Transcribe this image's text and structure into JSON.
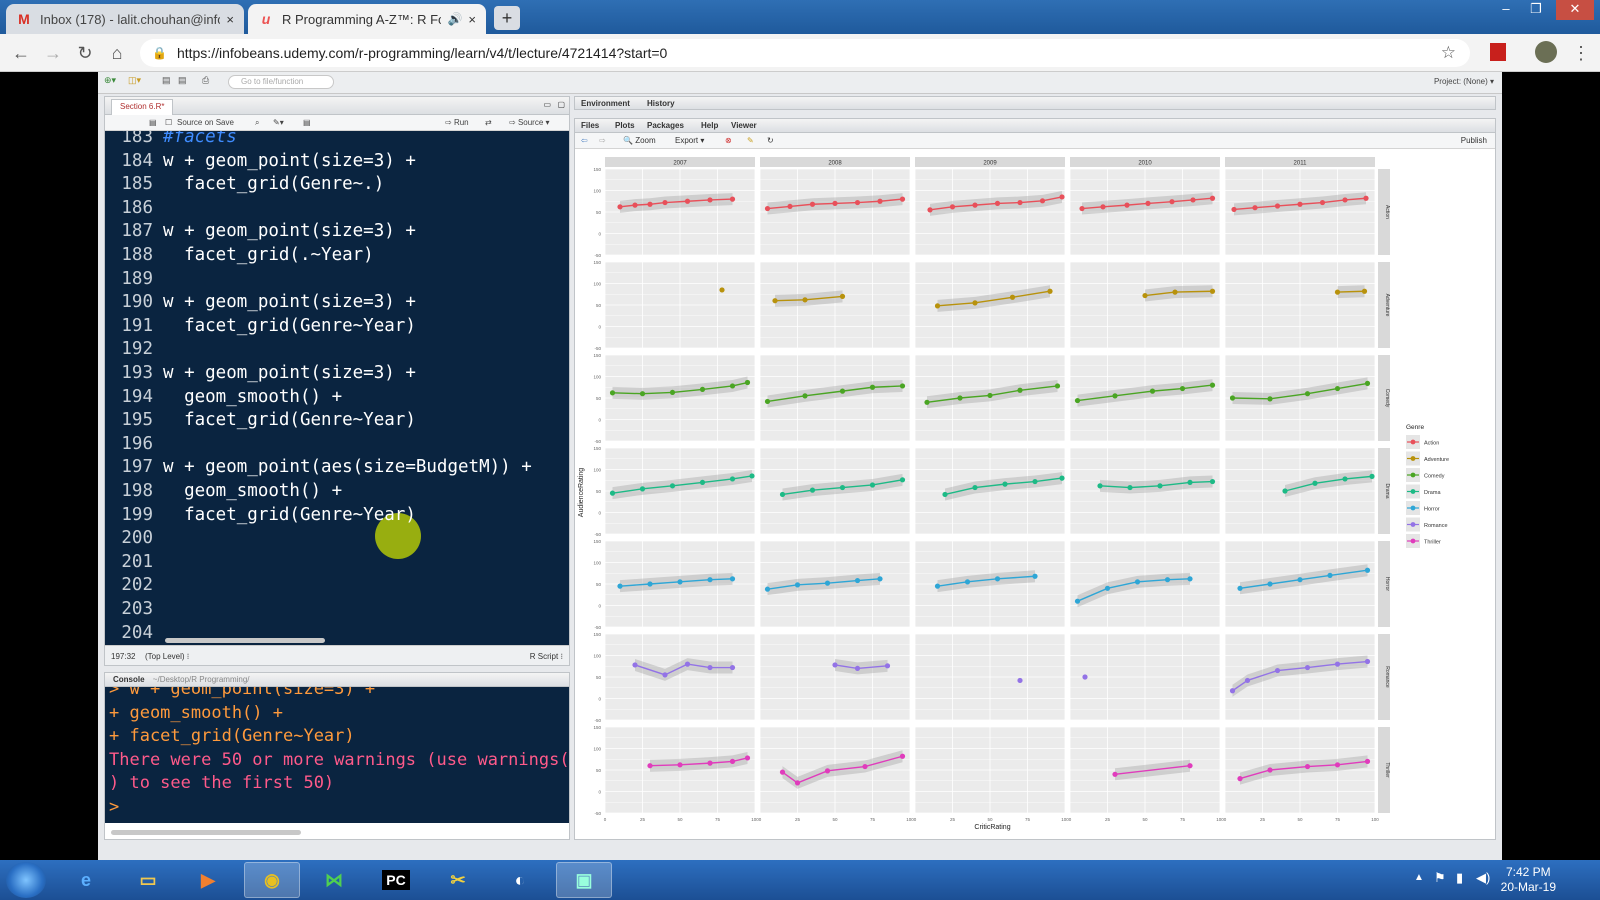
{
  "browser": {
    "tabs": [
      {
        "icon": "M",
        "title": "Inbox (178) - lalit.chouhan@infob",
        "close": "×"
      },
      {
        "icon": "u",
        "title": "R Programming A-Z™: R For",
        "close": "×"
      }
    ],
    "new_tab": "+",
    "url": "https://infobeans.udemy.com/r-programming/learn/v4/t/lecture/4721414?start=0"
  },
  "rstudio": {
    "toolbar": {
      "goto_placeholder": "Go to file/function",
      "project": "Project: (None) ▾"
    },
    "source": {
      "tab": "Section 6.R*",
      "tools": {
        "source_on_save": "Source on Save",
        "run": "Run",
        "source": "Source"
      },
      "lines": [
        {
          "n": "183",
          "code": "#facets",
          "kind": "comment"
        },
        {
          "n": "184",
          "code": "w + geom_point(size=3) +"
        },
        {
          "n": "185",
          "code": "  facet_grid(Genre~.)"
        },
        {
          "n": "186",
          "code": ""
        },
        {
          "n": "187",
          "code": "w + geom_point(size=3) +"
        },
        {
          "n": "188",
          "code": "  facet_grid(.~Year)"
        },
        {
          "n": "189",
          "code": ""
        },
        {
          "n": "190",
          "code": "w + geom_point(size=3) +"
        },
        {
          "n": "191",
          "code": "  facet_grid(Genre~Year)"
        },
        {
          "n": "192",
          "code": ""
        },
        {
          "n": "193",
          "code": "w + geom_point(size=3) +"
        },
        {
          "n": "194",
          "code": "  geom_smooth() +"
        },
        {
          "n": "195",
          "code": "  facet_grid(Genre~Year)"
        },
        {
          "n": "196",
          "code": ""
        },
        {
          "n": "197",
          "code": "w + geom_point(aes(size=BudgetM)) +"
        },
        {
          "n": "198",
          "code": "  geom_smooth() +"
        },
        {
          "n": "199",
          "code": "  facet_grid(Genre~Year)"
        },
        {
          "n": "200",
          "code": ""
        },
        {
          "n": "201",
          "code": ""
        },
        {
          "n": "202",
          "code": ""
        },
        {
          "n": "203",
          "code": ""
        },
        {
          "n": "204",
          "code": ""
        }
      ],
      "status": {
        "position": "197:32",
        "scope": "(Top Level) ⁝",
        "type": "R Script ⁝"
      }
    },
    "console": {
      "title": "Console",
      "path": "~/Desktop/R Programming/",
      "lines": [
        {
          "text": "> w + geom_point(size=3) +",
          "color": "orange"
        },
        {
          "text": "+ geom_smooth() +",
          "color": "orange"
        },
        {
          "text": "+ facet_grid(Genre~Year)",
          "color": "orange"
        },
        {
          "text": "There were 50 or more warnings (use warnings(",
          "color": "pink"
        },
        {
          "text": ") to see the first 50)",
          "color": "pink"
        },
        {
          "text": "> ",
          "color": "orange"
        }
      ]
    },
    "env_tabs": [
      "Environment",
      "History"
    ],
    "plot_tabs": [
      "Files",
      "Plots",
      "Packages",
      "Help",
      "Viewer"
    ],
    "plot_tools": {
      "zoom": "Zoom",
      "export": "Export ▾",
      "publish": "Publish"
    }
  },
  "chart_data": {
    "type": "scatter",
    "facet_rows": [
      "Action",
      "Adventure",
      "Comedy",
      "Drama",
      "Horror",
      "Romance",
      "Thriller"
    ],
    "facet_cols": [
      "2007",
      "2008",
      "2009",
      "2010",
      "2011"
    ],
    "xlabel": "CriticRating",
    "ylabel": "AudienceRating",
    "xlim": [
      0,
      100
    ],
    "ylim": [
      -50,
      150
    ],
    "x_ticks": [
      0,
      25,
      50,
      75,
      100
    ],
    "y_ticks": [
      -50,
      -25,
      0,
      25,
      50,
      75,
      100,
      125,
      150
    ],
    "legend_title": "Genre",
    "legend": [
      {
        "name": "Action",
        "color": "#e8505a"
      },
      {
        "name": "Adventure",
        "color": "#b8920c"
      },
      {
        "name": "Comedy",
        "color": "#4aa523"
      },
      {
        "name": "Drama",
        "color": "#1dba86"
      },
      {
        "name": "Horror",
        "color": "#2ea6d6"
      },
      {
        "name": "Romance",
        "color": "#9373e6"
      },
      {
        "name": "Thriller",
        "color": "#e03cbc"
      }
    ],
    "panels": {
      "Action": [
        [
          [
            10,
            62
          ],
          [
            20,
            66
          ],
          [
            30,
            68
          ],
          [
            40,
            72
          ],
          [
            55,
            75
          ],
          [
            70,
            78
          ],
          [
            85,
            80
          ]
        ],
        [
          [
            5,
            58
          ],
          [
            20,
            63
          ],
          [
            35,
            68
          ],
          [
            50,
            70
          ],
          [
            65,
            72
          ],
          [
            80,
            75
          ],
          [
            95,
            80
          ]
        ],
        [
          [
            10,
            55
          ],
          [
            25,
            62
          ],
          [
            40,
            66
          ],
          [
            55,
            70
          ],
          [
            70,
            72
          ],
          [
            85,
            76
          ],
          [
            98,
            85
          ]
        ],
        [
          [
            8,
            58
          ],
          [
            22,
            62
          ],
          [
            38,
            66
          ],
          [
            52,
            70
          ],
          [
            68,
            74
          ],
          [
            82,
            78
          ],
          [
            95,
            82
          ]
        ],
        [
          [
            6,
            56
          ],
          [
            20,
            60
          ],
          [
            35,
            64
          ],
          [
            50,
            68
          ],
          [
            65,
            72
          ],
          [
            80,
            78
          ],
          [
            94,
            82
          ]
        ]
      ],
      "Adventure": [
        [
          [
            78,
            85
          ]
        ],
        [
          [
            10,
            60
          ],
          [
            30,
            62
          ],
          [
            55,
            70
          ]
        ],
        [
          [
            15,
            48
          ],
          [
            40,
            55
          ],
          [
            65,
            68
          ],
          [
            90,
            82
          ]
        ],
        [
          [
            50,
            72
          ],
          [
            70,
            80
          ],
          [
            95,
            82
          ]
        ],
        [
          [
            75,
            80
          ],
          [
            93,
            82
          ]
        ]
      ],
      "Comedy": [
        [
          [
            5,
            62
          ],
          [
            25,
            60
          ],
          [
            45,
            63
          ],
          [
            65,
            70
          ],
          [
            85,
            78
          ],
          [
            95,
            86
          ]
        ],
        [
          [
            5,
            42
          ],
          [
            30,
            55
          ],
          [
            55,
            66
          ],
          [
            75,
            75
          ],
          [
            95,
            78
          ]
        ],
        [
          [
            8,
            40
          ],
          [
            30,
            50
          ],
          [
            50,
            56
          ],
          [
            70,
            68
          ],
          [
            95,
            78
          ]
        ],
        [
          [
            5,
            44
          ],
          [
            30,
            55
          ],
          [
            55,
            66
          ],
          [
            75,
            72
          ],
          [
            95,
            80
          ]
        ],
        [
          [
            5,
            50
          ],
          [
            30,
            48
          ],
          [
            55,
            60
          ],
          [
            75,
            72
          ],
          [
            95,
            84
          ]
        ]
      ],
      "Drama": [
        [
          [
            5,
            45
          ],
          [
            25,
            55
          ],
          [
            45,
            62
          ],
          [
            65,
            70
          ],
          [
            85,
            78
          ],
          [
            98,
            85
          ]
        ],
        [
          [
            15,
            42
          ],
          [
            35,
            52
          ],
          [
            55,
            58
          ],
          [
            75,
            64
          ],
          [
            95,
            76
          ]
        ],
        [
          [
            20,
            42
          ],
          [
            40,
            58
          ],
          [
            60,
            66
          ],
          [
            80,
            72
          ],
          [
            98,
            80
          ]
        ],
        [
          [
            20,
            62
          ],
          [
            40,
            58
          ],
          [
            60,
            62
          ],
          [
            80,
            70
          ],
          [
            95,
            72
          ]
        ],
        [
          [
            40,
            50
          ],
          [
            60,
            68
          ],
          [
            80,
            78
          ],
          [
            98,
            84
          ]
        ]
      ],
      "Horror": [
        [
          [
            10,
            45
          ],
          [
            30,
            50
          ],
          [
            50,
            55
          ],
          [
            70,
            60
          ],
          [
            85,
            62
          ]
        ],
        [
          [
            5,
            38
          ],
          [
            25,
            48
          ],
          [
            45,
            52
          ],
          [
            65,
            58
          ],
          [
            80,
            62
          ]
        ],
        [
          [
            15,
            45
          ],
          [
            35,
            55
          ],
          [
            55,
            62
          ],
          [
            80,
            68
          ]
        ],
        [
          [
            5,
            10
          ],
          [
            25,
            40
          ],
          [
            45,
            55
          ],
          [
            65,
            60
          ],
          [
            80,
            62
          ]
        ],
        [
          [
            10,
            40
          ],
          [
            30,
            50
          ],
          [
            50,
            60
          ],
          [
            70,
            70
          ],
          [
            95,
            82
          ]
        ]
      ],
      "Romance": [
        [
          [
            20,
            78
          ],
          [
            40,
            55
          ],
          [
            55,
            80
          ],
          [
            70,
            72
          ],
          [
            85,
            72
          ]
        ],
        [
          [
            50,
            78
          ],
          [
            65,
            70
          ],
          [
            85,
            76
          ]
        ],
        [
          [
            70,
            42
          ]
        ],
        [
          [
            10,
            50
          ]
        ],
        [
          [
            5,
            18
          ],
          [
            15,
            42
          ],
          [
            35,
            65
          ],
          [
            55,
            72
          ],
          [
            75,
            80
          ],
          [
            95,
            86
          ]
        ]
      ],
      "Thriller": [
        [
          [
            30,
            60
          ],
          [
            50,
            62
          ],
          [
            70,
            66
          ],
          [
            85,
            70
          ],
          [
            95,
            78
          ]
        ],
        [
          [
            15,
            45
          ],
          [
            25,
            20
          ],
          [
            45,
            48
          ],
          [
            70,
            58
          ],
          [
            95,
            82
          ]
        ],
        [],
        [
          [
            30,
            40
          ],
          [
            80,
            60
          ]
        ],
        [
          [
            10,
            30
          ],
          [
            30,
            50
          ],
          [
            55,
            58
          ],
          [
            75,
            62
          ],
          [
            95,
            70
          ]
        ]
      ]
    }
  },
  "taskbar": {
    "apps": [
      "IE",
      "Explorer",
      "Media",
      "Chrome",
      "VS",
      "PC",
      "Paint",
      "Eclipse",
      "RStudio"
    ],
    "time": "7:42 PM",
    "date": "20-Mar-19"
  }
}
